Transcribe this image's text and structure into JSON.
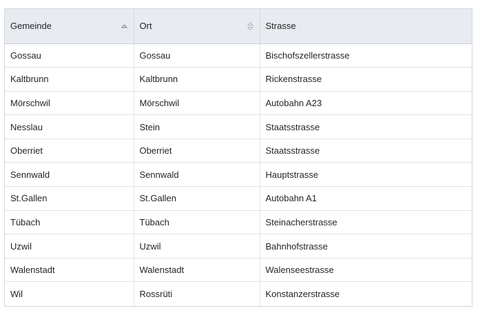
{
  "table": {
    "columns": [
      {
        "label": "Gemeinde",
        "sort": "ascending"
      },
      {
        "label": "Ort",
        "sort": "none"
      },
      {
        "label": "Strasse",
        "sort": "disabled"
      }
    ],
    "rows": [
      [
        "Gossau",
        "Gossau",
        "Bischofszellerstrasse"
      ],
      [
        "Kaltbrunn",
        "Kaltbrunn",
        "Rickenstrasse"
      ],
      [
        "Mörschwil",
        "Mörschwil",
        "Autobahn A23"
      ],
      [
        "Nesslau",
        "Stein",
        "Staatsstrasse"
      ],
      [
        "Oberriet",
        "Oberriet",
        "Staatsstrasse"
      ],
      [
        "Sennwald",
        "Sennwald",
        "Hauptstrasse"
      ],
      [
        "St.Gallen",
        "St.Gallen",
        "Autobahn A1"
      ],
      [
        "Tübach",
        "Tübach",
        "Steinacherstrasse"
      ],
      [
        "Uzwil",
        "Uzwil",
        "Bahnhofstrasse"
      ],
      [
        "Walenstadt",
        "Walenstadt",
        "Walenseestrasse"
      ],
      [
        "Wil",
        "Rossrüti",
        "Konstanzerstrasse"
      ]
    ]
  }
}
